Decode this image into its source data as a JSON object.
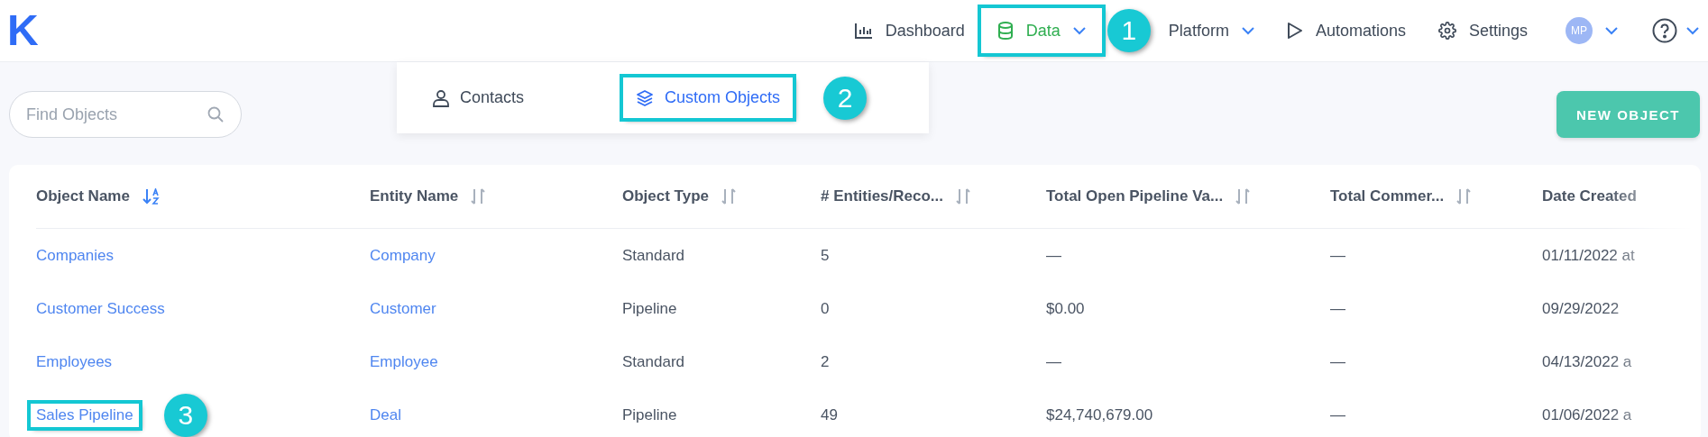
{
  "logo": "K",
  "nav": [
    {
      "label": "Dashboard",
      "selected": false,
      "dropdown": false
    },
    {
      "label": "Data",
      "selected": true,
      "dropdown": true,
      "callout": "1"
    },
    {
      "label": "Platform",
      "selected": false,
      "dropdown": true
    },
    {
      "label": "Automations",
      "selected": false,
      "dropdown": false
    },
    {
      "label": "Settings",
      "selected": false,
      "dropdown": false
    }
  ],
  "user": {
    "initials": "MP"
  },
  "data_menu": [
    {
      "label": "Contacts",
      "selected": false
    },
    {
      "label": "Custom Objects",
      "selected": true,
      "callout": "2"
    }
  ],
  "search": {
    "placeholder": "Find Objects"
  },
  "new_button": "NEW OBJECT",
  "table": {
    "columns": [
      {
        "label": "Object Name",
        "sorted": true
      },
      {
        "label": "Entity Name",
        "sorted": false
      },
      {
        "label": "Object Type",
        "sorted": false
      },
      {
        "label": "# Entities/Reco...",
        "sorted": false
      },
      {
        "label": "Total Open Pipeline Va...",
        "sorted": false
      },
      {
        "label": "Total Commer...",
        "sorted": false
      },
      {
        "label": "Date Created"
      }
    ],
    "rows": [
      {
        "object_name": "Companies",
        "entity_name": "Company",
        "object_type": "Standard",
        "entities": "5",
        "open_pipeline": "—",
        "commercial": "—",
        "date_created": "01/11/2022 at"
      },
      {
        "object_name": "Customer Success",
        "entity_name": "Customer",
        "object_type": "Pipeline",
        "entities": "0",
        "open_pipeline": "$0.00",
        "commercial": "—",
        "date_created": "09/29/2022"
      },
      {
        "object_name": "Employees",
        "entity_name": "Employee",
        "object_type": "Standard",
        "entities": "2",
        "open_pipeline": "—",
        "commercial": "—",
        "date_created": "04/13/2022 a"
      },
      {
        "object_name": "Sales Pipeline",
        "entity_name": "Deal",
        "object_type": "Pipeline",
        "entities": "49",
        "open_pipeline": "$24,740,679.00",
        "commercial": "—",
        "date_created": "01/06/2022 a",
        "callout": "3"
      }
    ]
  }
}
